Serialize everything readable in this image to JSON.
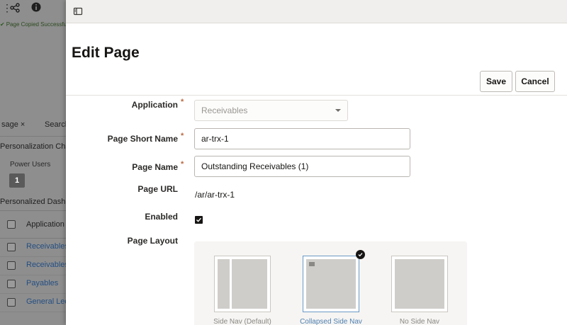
{
  "background": {
    "toast_message": "Page Copied Successfully",
    "tabs": [
      "sage",
      "Search"
    ],
    "tab_close_glyph": "×",
    "section_heading": "Personalization Changes",
    "power_users_label": "Power Users",
    "power_users_count": "1",
    "dashboard_heading": "Personalized Dashboards",
    "table": {
      "header": "Application",
      "rows": [
        "Receivables",
        "Receivables",
        "Payables",
        "General Ledger"
      ]
    }
  },
  "drawer": {
    "title": "Edit Page",
    "save_label": "Save",
    "cancel_label": "Cancel",
    "required_marker": "*",
    "fields": {
      "application_label": "Application",
      "application_value": "Receivables",
      "short_name_label": "Page Short Name",
      "short_name_value": "ar-trx-1",
      "page_name_label": "Page Name",
      "page_name_value": "Outstanding Receivables (1)",
      "url_label": "Page URL",
      "url_value": "/ar/ar-trx-1",
      "enabled_label": "Enabled",
      "enabled": true,
      "layout_label": "Page Layout"
    },
    "layouts": [
      {
        "label": "Side Nav (Default)",
        "selected": false
      },
      {
        "label": "Collapsed Side Nav",
        "selected": true
      },
      {
        "label": "No Side Nav",
        "selected": false
      }
    ]
  },
  "icons": {
    "share": "share-icon",
    "info": "info-icon",
    "panel": "panel-toggle-icon",
    "check": "check-icon"
  },
  "colors": {
    "required": "#ba6a44",
    "link": "#4f7fb0",
    "selected_border": "#6a99c7"
  }
}
